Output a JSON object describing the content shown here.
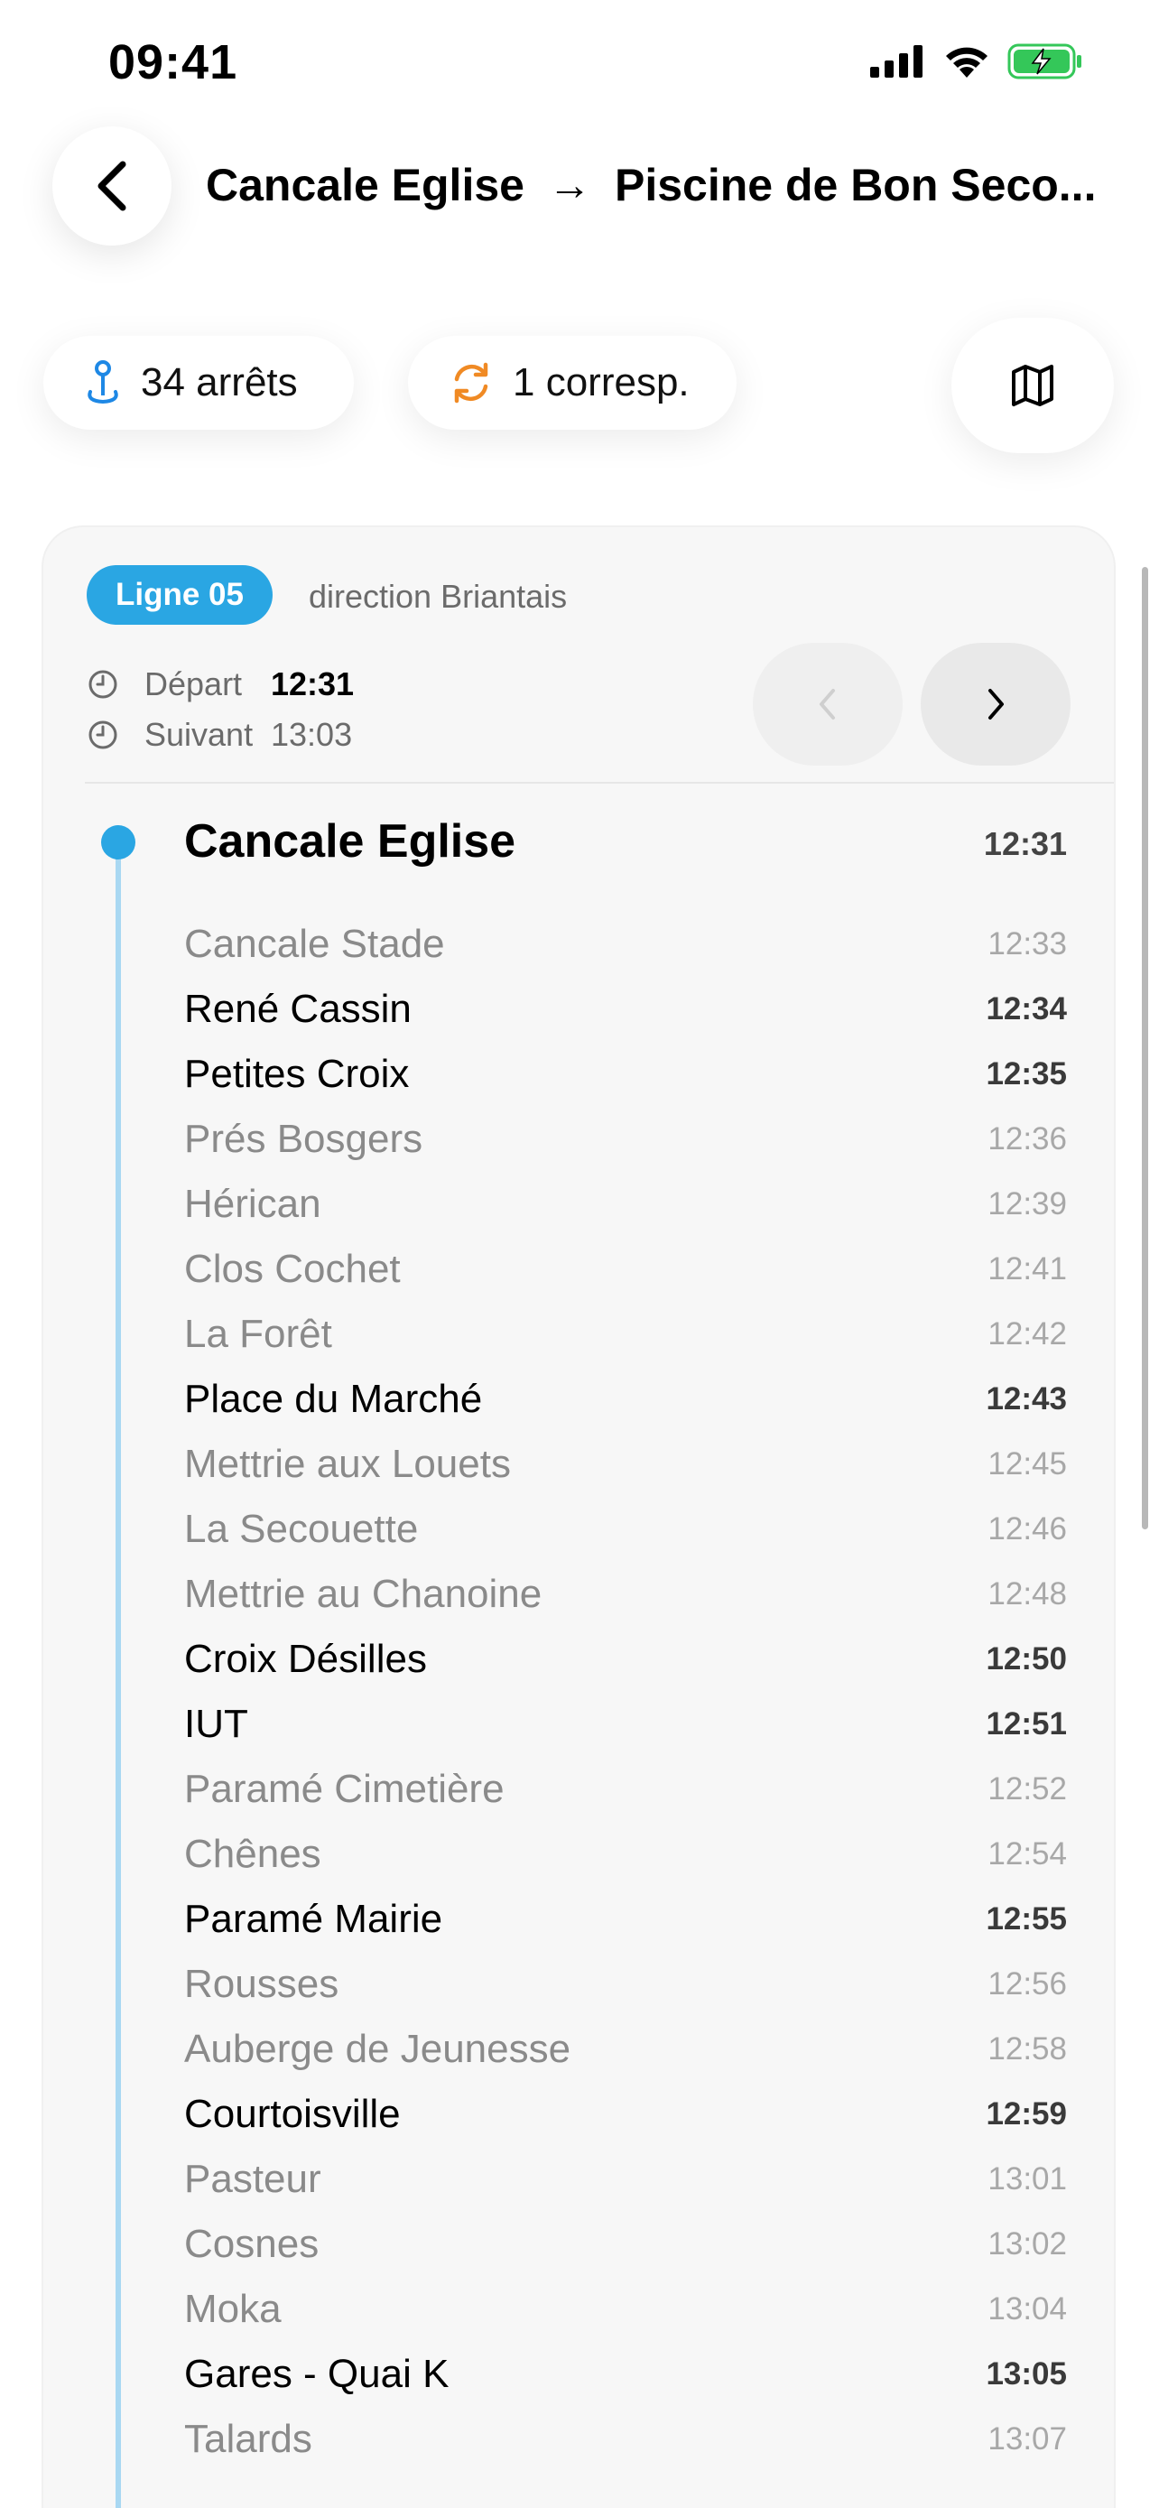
{
  "status_bar": {
    "time": "09:41"
  },
  "header": {
    "from": "Cancale Eglise",
    "arrow": "→",
    "to": "Piscine de Bon Seco..."
  },
  "chips": {
    "stops_label": "34 arrêts",
    "transfers_label": "1 corresp."
  },
  "line": {
    "badge": "Ligne 05",
    "direction": "direction Briantais",
    "departure_label": "Départ",
    "departure_time": "12:31",
    "next_label": "Suivant",
    "next_time": "13:03",
    "accent_color": "#2aa6e3"
  },
  "first_stop": {
    "name": "Cancale Eglise",
    "time": "12:31"
  },
  "stops": [
    {
      "name": "Cancale Stade",
      "time": "12:33",
      "major": false
    },
    {
      "name": "René Cassin",
      "time": "12:34",
      "major": true
    },
    {
      "name": "Petites Croix",
      "time": "12:35",
      "major": true
    },
    {
      "name": "Prés Bosgers",
      "time": "12:36",
      "major": false
    },
    {
      "name": "Hérican",
      "time": "12:39",
      "major": false
    },
    {
      "name": "Clos Cochet",
      "time": "12:41",
      "major": false
    },
    {
      "name": "La Forêt",
      "time": "12:42",
      "major": false
    },
    {
      "name": "Place du Marché",
      "time": "12:43",
      "major": true
    },
    {
      "name": "Mettrie aux Louets",
      "time": "12:45",
      "major": false
    },
    {
      "name": "La Secouette",
      "time": "12:46",
      "major": false
    },
    {
      "name": "Mettrie au Chanoine",
      "time": "12:48",
      "major": false
    },
    {
      "name": "Croix Désilles",
      "time": "12:50",
      "major": true
    },
    {
      "name": "IUT",
      "time": "12:51",
      "major": true
    },
    {
      "name": "Paramé Cimetière",
      "time": "12:52",
      "major": false
    },
    {
      "name": "Chênes",
      "time": "12:54",
      "major": false
    },
    {
      "name": "Paramé Mairie",
      "time": "12:55",
      "major": true
    },
    {
      "name": "Rousses",
      "time": "12:56",
      "major": false
    },
    {
      "name": "Auberge de Jeunesse",
      "time": "12:58",
      "major": false
    },
    {
      "name": "Courtoisville",
      "time": "12:59",
      "major": true
    },
    {
      "name": "Pasteur",
      "time": "13:01",
      "major": false
    },
    {
      "name": "Cosnes",
      "time": "13:02",
      "major": false
    },
    {
      "name": "Moka",
      "time": "13:04",
      "major": false
    },
    {
      "name": "Gares - Quai K",
      "time": "13:05",
      "major": true
    },
    {
      "name": "Talards",
      "time": "13:07",
      "major": false
    }
  ],
  "icons": {
    "back": "chevron-left-icon",
    "stops": "location-pin-icon",
    "transfer": "refresh-icon",
    "map": "map-icon",
    "prev": "chevron-left-icon",
    "next": "chevron-right-icon",
    "clock": "clock-icon"
  }
}
